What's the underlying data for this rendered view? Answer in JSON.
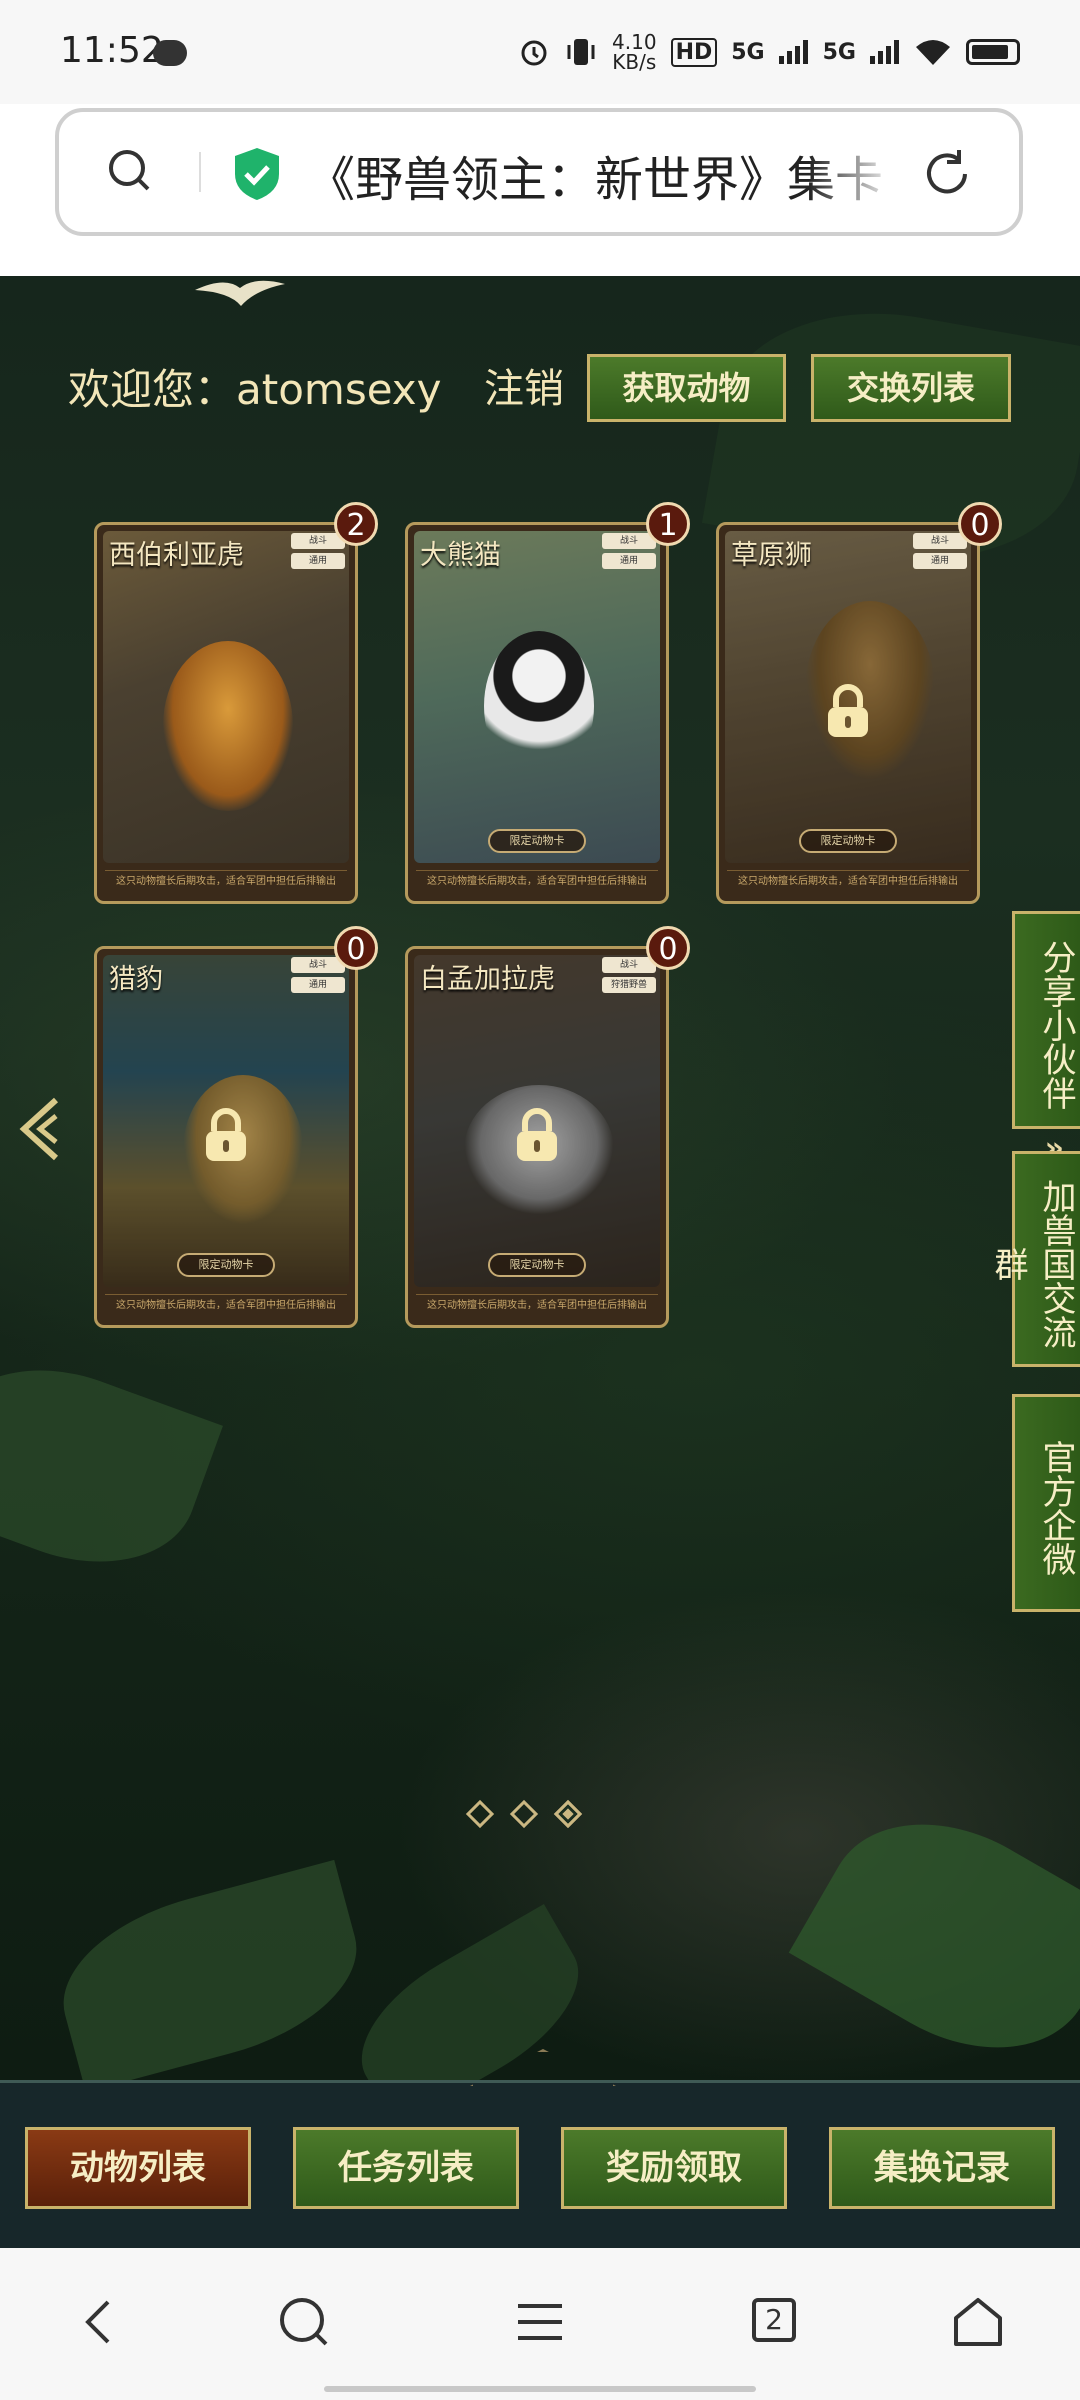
{
  "status_bar": {
    "time": "11:52",
    "net_speed_top": "4.10",
    "net_speed_unit": "KB/s",
    "hd": "HD",
    "sig1": "5G",
    "sig2": "5G"
  },
  "url_bar": {
    "title": "《野兽领主：新世界》集卡"
  },
  "header": {
    "welcome": "欢迎您：atomsexy",
    "logout": "注销",
    "get_animals": "获取动物",
    "exchange_list": "交换列表"
  },
  "cards": [
    {
      "name": "西伯利亚虎",
      "count": "2",
      "locked": false,
      "limited": "",
      "tag1": "战斗",
      "tag2": "通用",
      "desc": "这只动物擅长后期攻击，适合军团中担任后排输出"
    },
    {
      "name": "大熊猫",
      "count": "1",
      "locked": false,
      "limited": "限定动物卡",
      "tag1": "战斗",
      "tag2": "通用",
      "desc": "这只动物擅长后期攻击，适合军团中担任后排输出"
    },
    {
      "name": "草原狮",
      "count": "0",
      "locked": true,
      "limited": "限定动物卡",
      "tag1": "战斗",
      "tag2": "通用",
      "desc": "这只动物擅长后期攻击，适合军团中担任后排输出"
    },
    {
      "name": "猎豹",
      "count": "0",
      "locked": true,
      "limited": "限定动物卡",
      "tag1": "战斗",
      "tag2": "通用",
      "desc": "这只动物擅长后期攻击，适合军团中担任后排输出"
    },
    {
      "name": "白孟加拉虎",
      "count": "0",
      "locked": true,
      "limited": "限定动物卡",
      "tag1": "战斗",
      "tag2": "狩猎野兽",
      "desc": "这只动物擅长后期攻击，适合军团中担任后排输出"
    }
  ],
  "side_tabs": {
    "share": "分享小伙伴",
    "group": "加兽国交流群",
    "official": "官方企微",
    "chevron": "»"
  },
  "pager": {
    "total": 3,
    "active": 3
  },
  "bottom_tabs": {
    "animals": "动物列表",
    "tasks": "任务列表",
    "rewards": "奖励领取",
    "records": "集换记录"
  },
  "nav": {
    "tabs_count": "2"
  }
}
